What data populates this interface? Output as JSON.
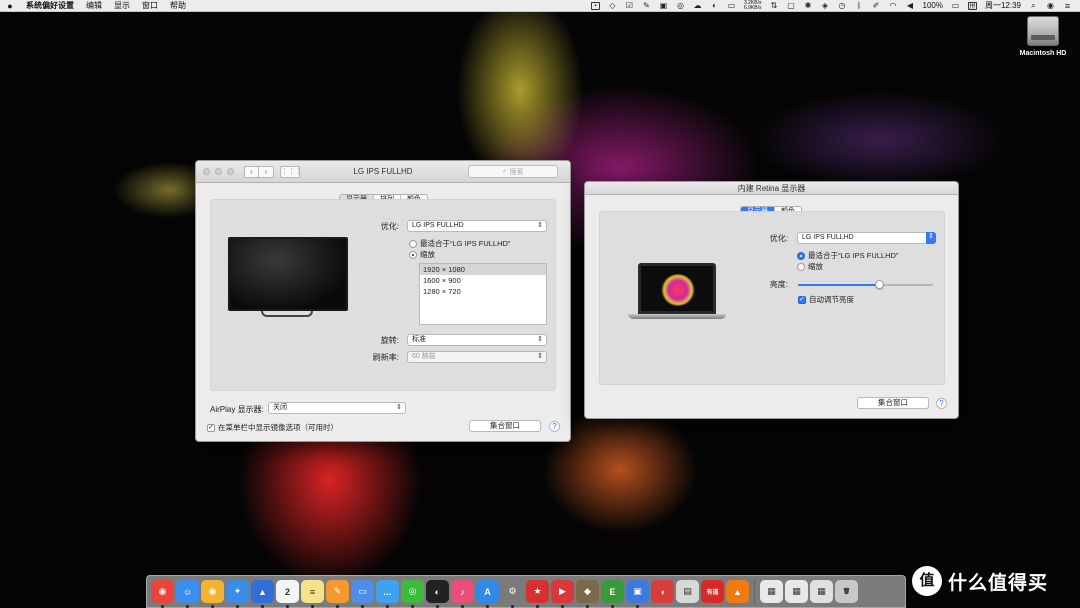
{
  "menubar": {
    "apple": "",
    "items": [
      "系统偏好设置",
      "编辑",
      "显示",
      "窗口",
      "帮助"
    ],
    "netspeed_up": "3.2KB/s",
    "netspeed_down": "6.9KB/s",
    "battery": "100%",
    "clock": "周一12:39"
  },
  "desktop": {
    "drive_label": "Macintosh HD"
  },
  "lg_window": {
    "title": "LG IPS FULLHD",
    "search_placeholder": "搜索",
    "tabs": [
      {
        "label": "显示器",
        "selected": true
      },
      {
        "label": "排列",
        "selected": false
      },
      {
        "label": "颜色",
        "selected": false
      }
    ],
    "optimize_label": "优化:",
    "optimize_value": "LG IPS FULLHD",
    "radio_best": "最适合于“LG IPS FULLHD”",
    "radio_scaled": "缩放",
    "resolutions": [
      "1920 × 1080",
      "1600 × 900",
      "1280 × 720"
    ],
    "rotation_label": "旋转:",
    "rotation_value": "标准",
    "refresh_label": "刷新率:",
    "refresh_value": "60 赫兹",
    "airplay_label": "AirPlay 显示器:",
    "airplay_value": "关闭",
    "mirror_checkbox": "在菜单栏中显示镜像选项（可用时）",
    "gather_button": "集合窗口",
    "help": "?"
  },
  "retina_window": {
    "title": "内建 Retina 显示器",
    "tabs": [
      {
        "label": "显示器",
        "selected": true
      },
      {
        "label": "颜色",
        "selected": false
      }
    ],
    "optimize_label": "优化:",
    "optimize_value": "LG IPS FULLHD",
    "radio_best": "最适合于“LG IPS FULLHD”",
    "radio_scaled": "缩放",
    "brightness_label": "亮度:",
    "brightness_level": 0.6,
    "auto_brightness": "自动调节亮度",
    "gather_button": "集合窗口",
    "help": "?"
  },
  "dock": {
    "apps": [
      {
        "name": "chrome",
        "glyph": "◉",
        "color": "#e8453c"
      },
      {
        "name": "finder",
        "glyph": "☺",
        "color": "#3c8ff0"
      },
      {
        "name": "chrome-2",
        "glyph": "◉",
        "color": "#f0b430"
      },
      {
        "name": "safari",
        "glyph": "✦",
        "color": "#3a8de6"
      },
      {
        "name": "launchpad",
        "glyph": "▲",
        "color": "#2f6fd6"
      },
      {
        "name": "calendar",
        "glyph": "2",
        "color": "#f5f5f5"
      },
      {
        "name": "notes",
        "glyph": "≡",
        "color": "#f5e38a"
      },
      {
        "name": "pages",
        "glyph": "✎",
        "color": "#f29a30"
      },
      {
        "name": "keynote",
        "glyph": "▭",
        "color": "#4c8ee8"
      },
      {
        "name": "messages",
        "glyph": "…",
        "color": "#3fa2f0"
      },
      {
        "name": "wechat",
        "glyph": "◎",
        "color": "#3dbb3d"
      },
      {
        "name": "qq",
        "glyph": "◐",
        "color": "#222222"
      },
      {
        "name": "itunes",
        "glyph": "♪",
        "color": "#e8507a"
      },
      {
        "name": "app-store",
        "glyph": "A",
        "color": "#2f8ae8"
      },
      {
        "name": "system-preferences",
        "glyph": "⚙",
        "color": "#7a7a7a"
      },
      {
        "name": "todo",
        "glyph": "★",
        "color": "#d83030"
      },
      {
        "name": "pdf",
        "glyph": "▶",
        "color": "#d8383c"
      },
      {
        "name": "archive",
        "glyph": "◆",
        "color": "#7a6a4c"
      },
      {
        "name": "evernote",
        "glyph": "E",
        "color": "#3a9a3a"
      },
      {
        "name": "xcode",
        "glyph": "▣",
        "color": "#3c7ae0"
      },
      {
        "name": "pocket",
        "glyph": "◖",
        "color": "#d83c3c"
      },
      {
        "name": "screenshot",
        "glyph": "▤",
        "color": "#d8d8d8"
      },
      {
        "name": "youdao",
        "glyph": "有道",
        "color": "#d82828"
      },
      {
        "name": "vlc",
        "glyph": "▲",
        "color": "#f07a10"
      },
      {
        "name": "doc-1",
        "glyph": "▦",
        "color": "#e8e8e8"
      },
      {
        "name": "doc-2",
        "glyph": "▦",
        "color": "#e8e8e8"
      },
      {
        "name": "doc-3",
        "glyph": "▦",
        "color": "#e0e0e0"
      },
      {
        "name": "trash",
        "glyph": "🗑",
        "color": "#c8c8c8"
      }
    ]
  },
  "watermark": {
    "logo": "值",
    "text": "什么值得买"
  }
}
